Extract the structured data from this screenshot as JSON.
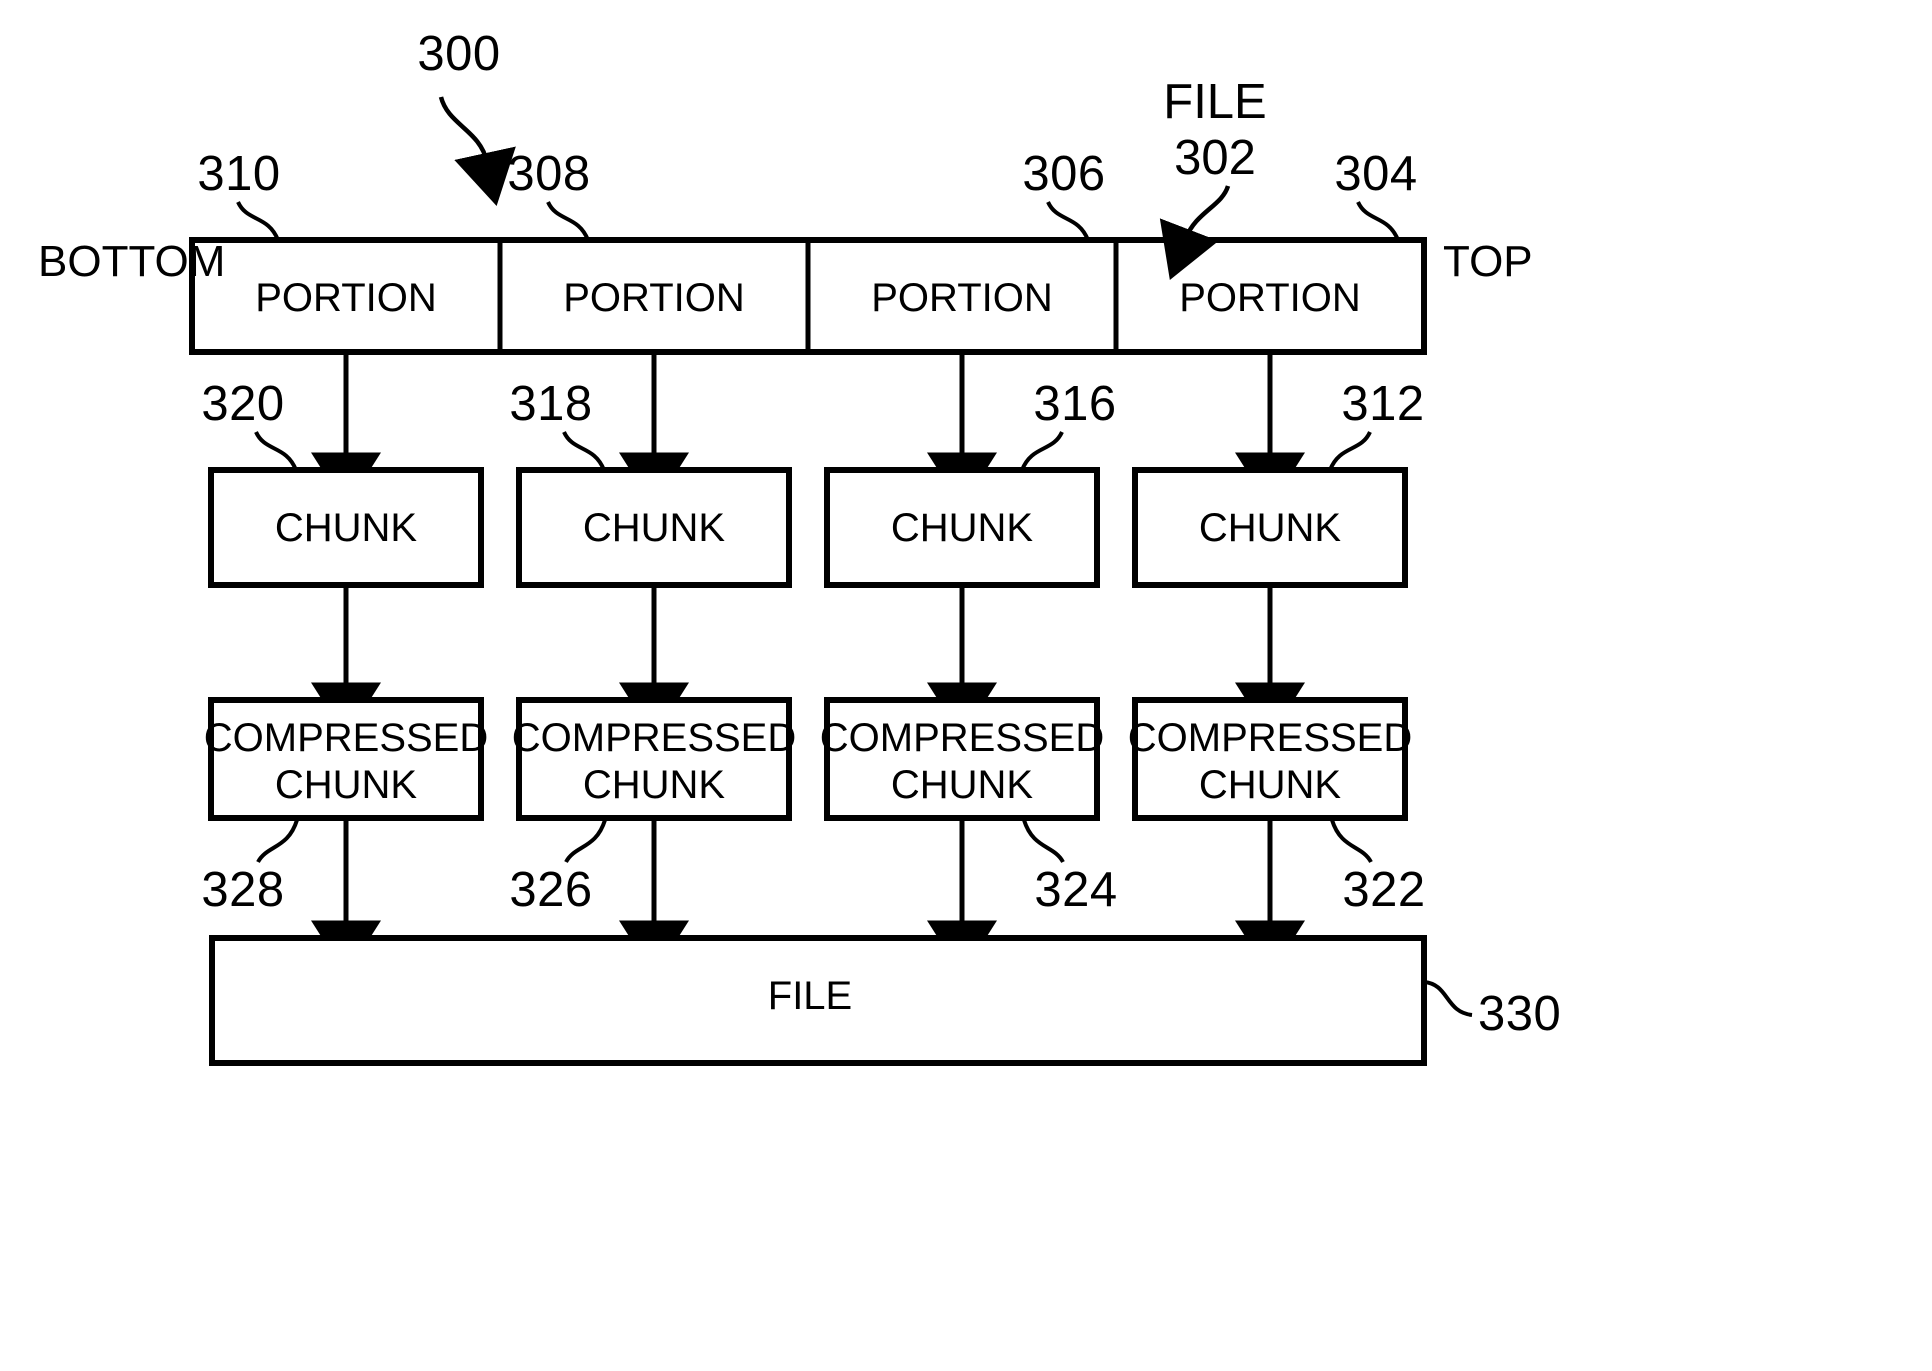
{
  "figure": {
    "number": "300",
    "edge_labels": {
      "bottom": "BOTTOM",
      "top": "TOP"
    },
    "file_callout": {
      "word": "FILE",
      "ref": "302"
    },
    "portion_row": {
      "refs": [
        "310",
        "308",
        "306",
        "304"
      ],
      "labels": [
        "PORTION",
        "PORTION",
        "PORTION",
        "PORTION"
      ]
    },
    "chunk_row": {
      "refs": [
        "320",
        "318",
        "316",
        "312"
      ],
      "labels": [
        "CHUNK",
        "CHUNK",
        "CHUNK",
        "CHUNK"
      ]
    },
    "compressed_row": {
      "refs": [
        "328",
        "326",
        "324",
        "322"
      ],
      "line1": [
        "COMPRESSED",
        "COMPRESSED",
        "COMPRESSED",
        "COMPRESSED"
      ],
      "line2": [
        "CHUNK",
        "CHUNK",
        "CHUNK",
        "CHUNK"
      ]
    },
    "file_bar": {
      "label": "FILE",
      "ref": "330"
    },
    "colors": {
      "stroke": "#000000",
      "fill": "#ffffff",
      "text": "#000000"
    }
  }
}
